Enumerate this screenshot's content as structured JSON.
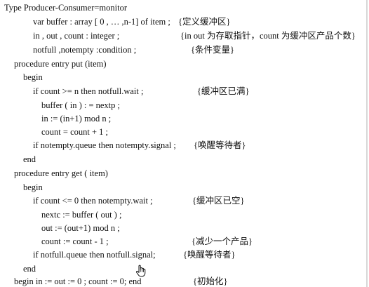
{
  "code": {
    "title": "Type Producer-Consumer=monitor",
    "decl_buffer": {
      "code": "var    buffer : array [ 0 , … ,n-1] of item ;",
      "comment": "{定义缓冲区}"
    },
    "decl_counters": {
      "code": "in , out , count : integer ;",
      "comment": "{in out 为存取指针，count 为缓冲区产品个数}"
    },
    "decl_conditions": {
      "code": "notfull ,notempty :condition ;",
      "comment": "{条件变量}"
    },
    "put_header": "procedure    entry    put (item)",
    "put_begin": "begin",
    "put_if": {
      "code": "if   count >= n    then    notfull.wait ;",
      "comment": "{缓冲区已满}"
    },
    "put_assign_buffer": "buffer ( in ) : = nextp ;",
    "put_assign_in": "in := (in+1) mod n ;",
    "put_increment": "count = count + 1 ;",
    "put_signal": {
      "code": "if notempty.queue    then notempty.signal ;",
      "comment": "{唤醒等待者}"
    },
    "put_end": "end",
    "get_header": "procedure entry    get ( item)",
    "get_begin": "begin",
    "get_if": {
      "code": "if count <= 0 then    notempty.wait ;",
      "comment": "{缓冲区已空}"
    },
    "get_assign_nextc": "nextc := buffer ( out ) ;",
    "get_assign_out": "out := (out+1) mod n ;",
    "get_decrement": {
      "code": "count := count - 1 ;",
      "comment": "{减少一个产品}"
    },
    "get_signal": {
      "code": "if    notfull.queue then notfull.signal;",
      "comment": "{唤醒等待者}"
    },
    "get_end": "end",
    "init": {
      "code": "begin    in := out := 0 ;    count := 0;    end",
      "comment": "{初始化}"
    }
  },
  "cursor": {
    "icon": "hand-cursor-icon"
  }
}
